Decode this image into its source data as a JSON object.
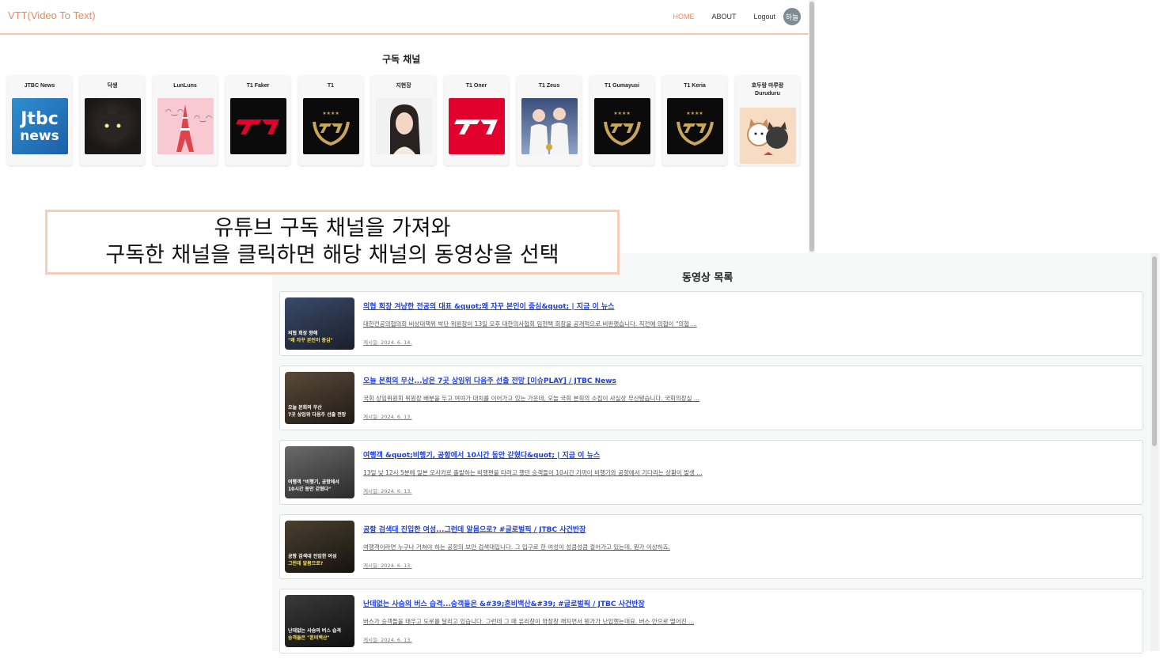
{
  "navbar": {
    "brand": "VTT(Video To Text)",
    "links": [
      "HOME",
      "ABOUT",
      "Logout"
    ],
    "avatar_text": "하늘"
  },
  "channels_section": {
    "title": "구독 채널",
    "channels": [
      {
        "name": "JTBC News"
      },
      {
        "name": "닥생"
      },
      {
        "name": "LunLuns"
      },
      {
        "name": "T1 Faker"
      },
      {
        "name": "T1"
      },
      {
        "name": "지현장"
      },
      {
        "name": "T1 Oner"
      },
      {
        "name": "T1 Zeus"
      },
      {
        "name": "T1 Gumayusi"
      },
      {
        "name": "T1 Keria"
      },
      {
        "name": "호두랑 마루랑 Duruduru"
      }
    ]
  },
  "callout": {
    "line1": "유튜브 구독 채널을 가져와",
    "line2": "구독한 채널을 클릭하면 해당 채널의 동영상을 선택"
  },
  "videos_section": {
    "title": "동영상 목록",
    "videos": [
      {
        "title": "의협 회장 겨냥한 전공의 대표 &quot;왜 자꾸 본인이 중심&quot; | 지금 이 뉴스",
        "desc": "대한전공의협의회 비상대책위 박단 위원장이 13일 오후 대한의사협회 임현택 회장을 공개적으로 비판했습니다. 직전에 의협이 \"의협 ...",
        "date": "게시일: 2024. 6. 14.",
        "thumb_cap1": "의협 회장 향해",
        "thumb_cap2": "\"왜 자꾸 본인이 중심\""
      },
      {
        "title": "오늘 본회의 무산...남은 7곳 상임위 다음주 선출 전망 [이슈PLAY] / JTBC News",
        "desc": "국회 상임위원회 위원장 배분을 두고 여야가 대치를 이어가고 있는 가운데, 오늘 국회 본회의 소집이 사실상 무산됐습니다. 국회의장실 ...",
        "date": "게시일: 2024. 6. 13.",
        "thumb_cap1": "오늘 본회의 무산",
        "thumb_cap2": "7곳 상임위 다음주 선출 전망"
      },
      {
        "title": "여행객 &quot;비행기, 공항에서 10시간 동안 갇혔다&quot; | 지금 이 뉴스",
        "desc": "13일 낮 12시 5분에 일본 오사카로 출발하는 비행편을 타려고 했던 승객들이 10시간 가까이 비행기와 공항에서 기다리는 상황이 발생 ...",
        "date": "게시일: 2024. 6. 13.",
        "thumb_cap1": "여행객 \"비행기, 공항에서",
        "thumb_cap2": "10시간 동안 갇혔다\""
      },
      {
        "title": "공항 검색대 진입한 여성...그런데 알몸으로? #글로벌픽 / JTBC 사건반장",
        "desc": "여행객이라면 누구나 거쳐야 하는 공항의 보안 검색대입니다. 그 입구로 한 여성이 성큼성큼 걸어가고 있는데, 뭔가 이상하죠.",
        "date": "게시일: 2024. 6. 13.",
        "thumb_cap1": "공항 검색대 진입한 여성",
        "thumb_cap2": "그런데 알몸으로?"
      },
      {
        "title": "난데없는 사슴의 버스 습격...승객들은 &#39;혼비백산&#39; #글로벌픽 / JTBC 사건반장",
        "desc": "버스가 승객들을 태우고 도로를 달리고 있습니다. 그런데 그 때 유리창이 와장창 깨지면서 뭔가가 난입했는데요. 버스 안으로 떨어진 ...",
        "date": "게시일: 2024. 6. 13.",
        "thumb_cap1": "난데없는 사슴의 버스 습격",
        "thumb_cap2": "승객들은 \"혼비백산\""
      }
    ]
  },
  "colors": {
    "brand": "#e98a61",
    "link_blue": "#1a3ee8",
    "callout_border": "#f5cdb8"
  }
}
